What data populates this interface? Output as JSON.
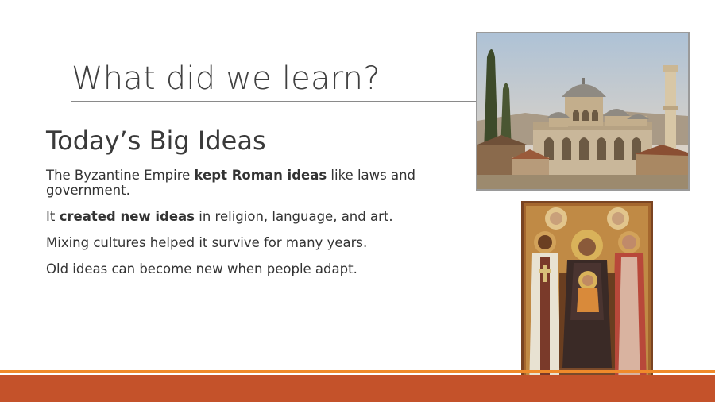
{
  "slide": {
    "title": "What did we learn?",
    "subtitle": "Today’s Big Ideas",
    "bullets": [
      {
        "pre": "The Byzantine Empire ",
        "bold": "kept Roman ideas",
        "post": " like laws and government."
      },
      {
        "pre": "It ",
        "bold": "created new ideas",
        "post": " in religion, language, and art."
      },
      {
        "pre": "Mixing cultures helped it survive for many years.",
        "bold": "",
        "post": ""
      },
      {
        "pre": "Old ideas can become new when people adapt.",
        "bold": "",
        "post": ""
      }
    ]
  },
  "colors": {
    "accent_orange": "#f08a2a",
    "accent_rust": "#c4522a",
    "title_gray": "#404040"
  },
  "images": {
    "photo1_icon": "byzantine-church-photo",
    "photo2_icon": "byzantine-icon-painting"
  }
}
